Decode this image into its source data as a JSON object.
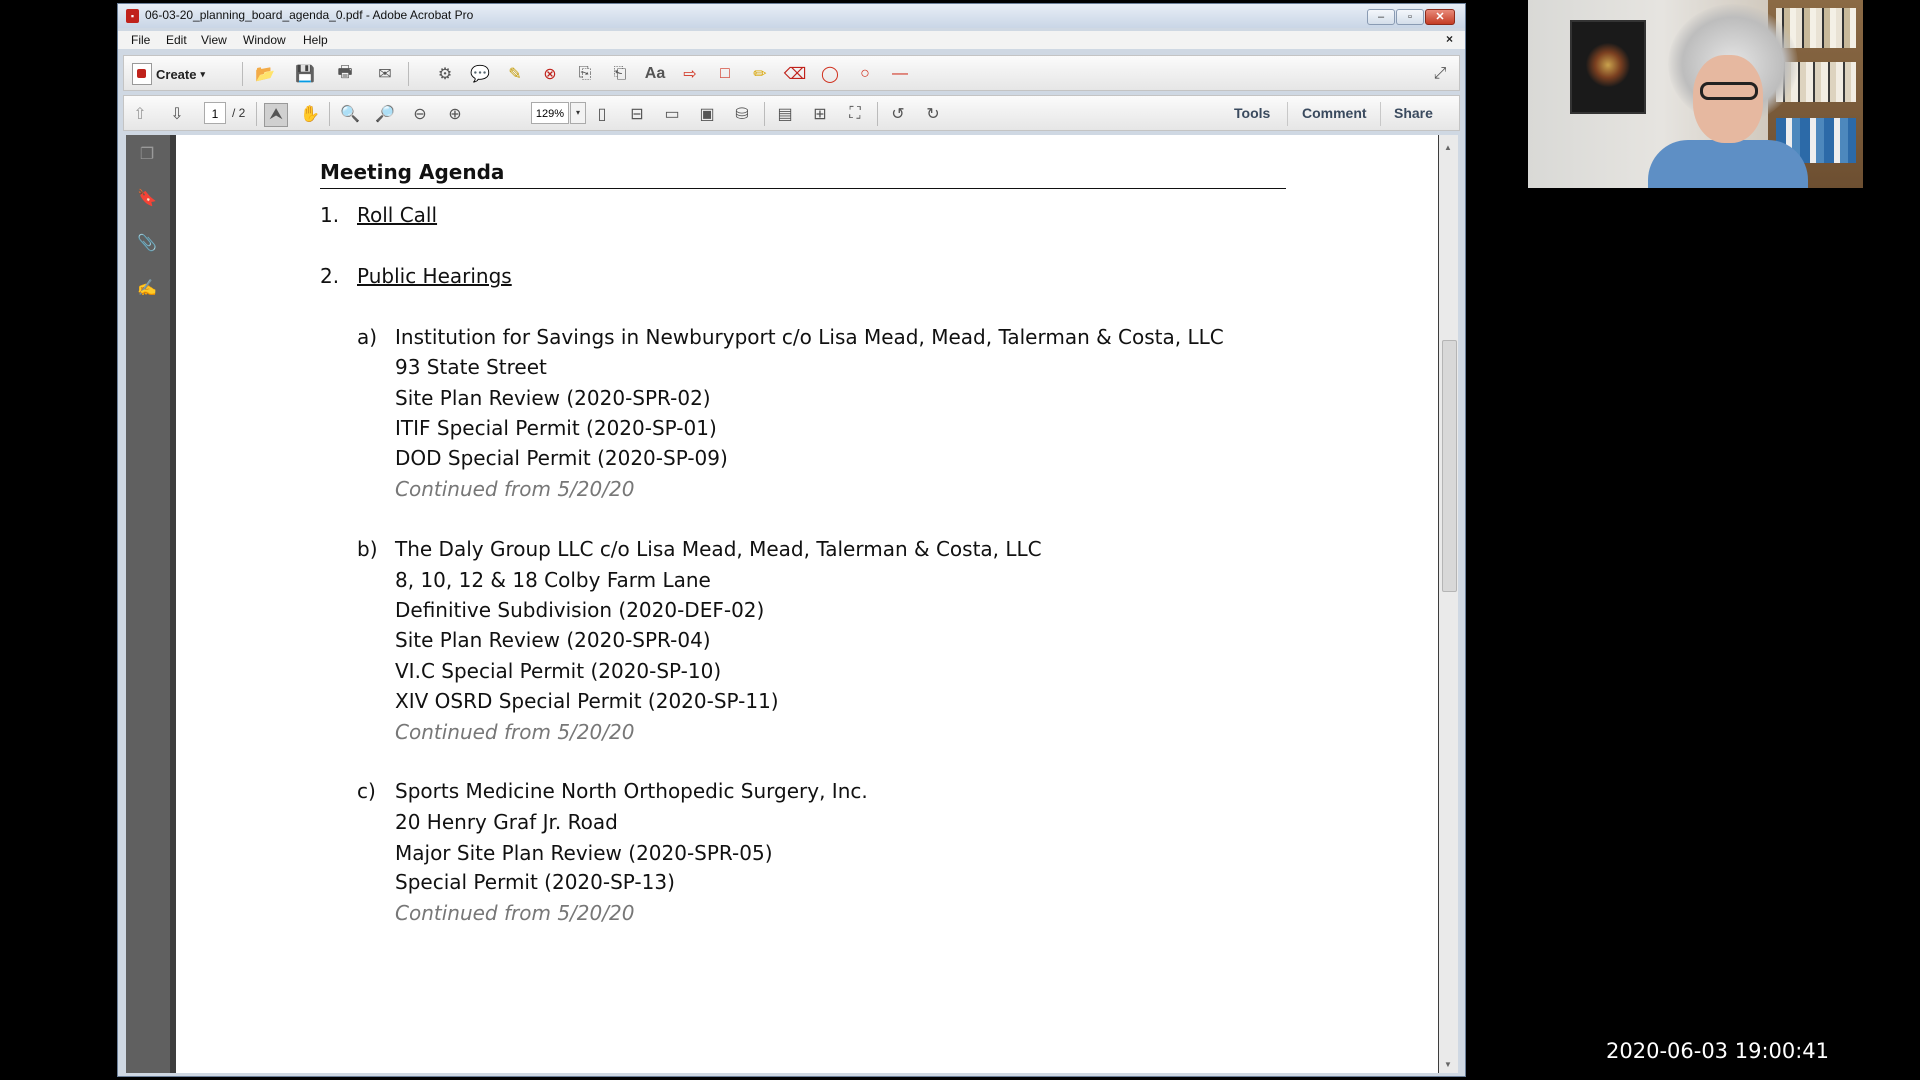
{
  "window": {
    "title": "06-03-20_planning_board_agenda_0.pdf - Adobe Acrobat Pro",
    "pdf_icon": "pdf-icon"
  },
  "menu": [
    "File",
    "Edit",
    "View",
    "Window",
    "Help"
  ],
  "toolbar": {
    "create_label": "Create",
    "page_current": "1",
    "page_total": "/ 2",
    "zoom": "129%",
    "tools_label": "Tools",
    "comment_label": "Comment",
    "share_label": "Share"
  },
  "document": {
    "heading": "Meeting Agenda",
    "items": [
      {
        "num": "1.",
        "label": "Roll Call"
      },
      {
        "num": "2.",
        "label": "Public Hearings"
      }
    ],
    "hearings": [
      {
        "letter": "a)",
        "lines": [
          "Institution for Savings in Newburyport c/o Lisa Mead, Mead, Talerman & Costa, LLC",
          "93 State Street",
          "Site Plan Review (2020-SPR-02)",
          "ITIF Special Permit (2020-SP-01)",
          "DOD Special Permit (2020-SP-09)"
        ],
        "note": "Continued from 5/20/20"
      },
      {
        "letter": "b)",
        "lines": [
          "The Daly Group LLC c/o Lisa Mead, Mead, Talerman & Costa, LLC",
          "8, 10, 12 & 18 Colby Farm Lane",
          "Definitive Subdivision (2020-DEF-02)",
          "Site Plan Review (2020-SPR-04)",
          "VI.C Special Permit (2020-SP-10)",
          "XIV OSRD Special Permit (2020-SP-11)"
        ],
        "note": "Continued from 5/20/20"
      },
      {
        "letter": "c)",
        "lines": [
          "Sports Medicine North Orthopedic Surgery, Inc.",
          "20 Henry Graf Jr. Road",
          "Major Site Plan Review (2020-SPR-05)",
          "Special Permit (2020-SP-13)"
        ],
        "note": "Continued from 5/20/20"
      }
    ]
  },
  "overlay": {
    "timestamp": "2020-06-03  19:00:41"
  }
}
